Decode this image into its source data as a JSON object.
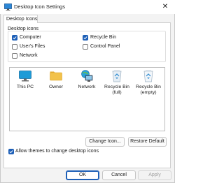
{
  "window": {
    "title": "Desktop Icon Settings",
    "close_glyph": "✕"
  },
  "tabs": [
    {
      "label": "Desktop Icons"
    }
  ],
  "desktop_icons_group": {
    "label": "Desktop icons",
    "options": [
      {
        "label": "Computer",
        "checked": true
      },
      {
        "label": "Recycle Bin",
        "checked": true
      },
      {
        "label": "User's Files",
        "checked": false
      },
      {
        "label": "Control Panel",
        "checked": false
      },
      {
        "label": "Network",
        "checked": false
      }
    ]
  },
  "icons": [
    {
      "line1": "This PC",
      "line2": "",
      "icon": "monitor-icon"
    },
    {
      "line1": "Owner",
      "line2": "",
      "icon": "folder-icon"
    },
    {
      "line1": "Network",
      "line2": "",
      "icon": "network-icon"
    },
    {
      "line1": "Recycle Bin",
      "line2": "(full)",
      "icon": "recycle-bin-full-icon"
    },
    {
      "line1": "Recycle Bin",
      "line2": "(empty)",
      "icon": "recycle-bin-empty-icon"
    }
  ],
  "buttons": {
    "change_icon": "Change Icon...",
    "restore_default": "Restore Default",
    "ok": "OK",
    "cancel": "Cancel",
    "apply": "Apply"
  },
  "themes_option": {
    "label": "Allow themes to change desktop icons",
    "checked": true
  },
  "colors": {
    "accent": "#1d5fb7",
    "folder": "#f2c24b",
    "monitor": "#1e9bd7"
  }
}
